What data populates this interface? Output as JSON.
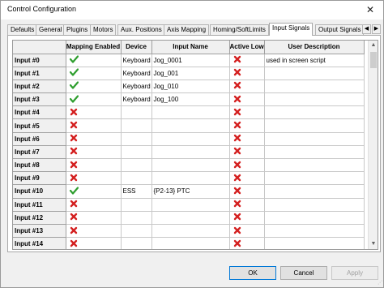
{
  "window": {
    "title": "Control Configuration"
  },
  "tabs": [
    "Defaults",
    "General",
    "Plugins",
    "Motors",
    "Aux. Positions",
    "Axis Mapping",
    "Homing/SoftLimits",
    "Input Signals",
    "Output Signals"
  ],
  "active_tab": "Input Signals",
  "table": {
    "columns": [
      "",
      "Mapping Enabled",
      "Device",
      "Input Name",
      "Active Low",
      "User Description"
    ],
    "rows": [
      {
        "name": "Input #0",
        "enabled": true,
        "device": "Keyboard",
        "input_name": "Jog_0001",
        "active_low": false,
        "description": "used in screen script"
      },
      {
        "name": "Input #1",
        "enabled": true,
        "device": "Keyboard",
        "input_name": "Jog_001",
        "active_low": false,
        "description": ""
      },
      {
        "name": "Input #2",
        "enabled": true,
        "device": "Keyboard",
        "input_name": "Jog_010",
        "active_low": false,
        "description": ""
      },
      {
        "name": "Input #3",
        "enabled": true,
        "device": "Keyboard",
        "input_name": "Jog_100",
        "active_low": false,
        "description": ""
      },
      {
        "name": "Input #4",
        "enabled": false,
        "device": "",
        "input_name": "",
        "active_low": false,
        "description": ""
      },
      {
        "name": "Input #5",
        "enabled": false,
        "device": "",
        "input_name": "",
        "active_low": false,
        "description": ""
      },
      {
        "name": "Input #6",
        "enabled": false,
        "device": "",
        "input_name": "",
        "active_low": false,
        "description": ""
      },
      {
        "name": "Input #7",
        "enabled": false,
        "device": "",
        "input_name": "",
        "active_low": false,
        "description": ""
      },
      {
        "name": "Input #8",
        "enabled": false,
        "device": "",
        "input_name": "",
        "active_low": false,
        "description": ""
      },
      {
        "name": "Input #9",
        "enabled": false,
        "device": "",
        "input_name": "",
        "active_low": false,
        "description": ""
      },
      {
        "name": "Input #10",
        "enabled": true,
        "device": "ESS",
        "input_name": "{P2-13} PTC",
        "active_low": false,
        "description": ""
      },
      {
        "name": "Input #11",
        "enabled": false,
        "device": "",
        "input_name": "",
        "active_low": false,
        "description": ""
      },
      {
        "name": "Input #12",
        "enabled": false,
        "device": "",
        "input_name": "",
        "active_low": false,
        "description": ""
      },
      {
        "name": "Input #13",
        "enabled": false,
        "device": "",
        "input_name": "",
        "active_low": false,
        "description": ""
      },
      {
        "name": "Input #14",
        "enabled": false,
        "device": "",
        "input_name": "",
        "active_low": false,
        "description": ""
      }
    ]
  },
  "icons": {
    "enabled": "green-check-icon",
    "disabled": "red-x-icon",
    "enabled_color": "#2e9e2e",
    "disabled_color": "#d42020"
  },
  "buttons": {
    "ok": "OK",
    "cancel": "Cancel",
    "apply": "Apply"
  }
}
